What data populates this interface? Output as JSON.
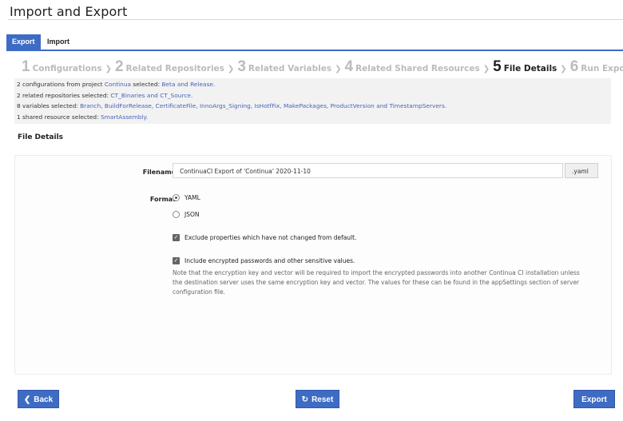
{
  "header": {
    "title": "Import and Export"
  },
  "tabs": [
    {
      "label": "Export",
      "active": true
    },
    {
      "label": "Import",
      "active": false
    }
  ],
  "wizard": {
    "steps": [
      {
        "num": "1",
        "label": "Configurations"
      },
      {
        "num": "2",
        "label": "Related Repositories"
      },
      {
        "num": "3",
        "label": "Related Variables"
      },
      {
        "num": "4",
        "label": "Related Shared Resources"
      },
      {
        "num": "5",
        "label": "File Details",
        "current": true
      },
      {
        "num": "6",
        "label": "Run Export"
      }
    ],
    "separator": "❯"
  },
  "summary": {
    "line1": {
      "prefix": "2 configurations from project ",
      "project": "Continua",
      "mid": " selected: ",
      "items": "Beta and Release."
    },
    "line2": {
      "prefix": "2 related repositories selected: ",
      "items": "CT_Binaries and CT_Source."
    },
    "line3": {
      "prefix": "8 variables selected: ",
      "items": "Branch, BuildForRelease, CertificateFile, InnoArgs_Signing, IsHotfFix, MakePackages, ProductVersion and TimestampServers."
    },
    "line4": {
      "prefix": "1 shared resource selected: ",
      "items": "SmartAssembly."
    }
  },
  "section": {
    "title": "File Details"
  },
  "form": {
    "filename_label": "Filename",
    "filename_value": "ContinuaCI Export of 'Continua' 2020-11-10",
    "extension": ".yaml",
    "format_label": "Format",
    "format_options": [
      {
        "label": "YAML",
        "selected": true
      },
      {
        "label": "JSON",
        "selected": false
      }
    ],
    "exclude_label": "Exclude properties which have not changed from default.",
    "exclude_checked": true,
    "include_label": "Include encrypted passwords and other sensitive values.",
    "include_checked": true,
    "note": "Note that the encryption key and vector will be required to import the encrypted passwords into another Continua CI installation unless the destination server uses the same encryption key and vector. The values for these can be found in the appSettings section of server configuration file."
  },
  "buttons": {
    "back": "Back",
    "reset": "Reset",
    "export": "Export"
  },
  "colors": {
    "accent": "#3e6cc4",
    "link": "#4a63b8"
  }
}
